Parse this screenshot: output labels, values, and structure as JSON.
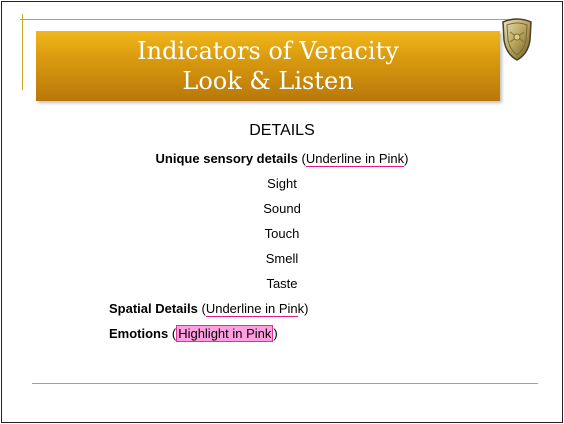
{
  "title": {
    "line1": "Indicators of Veracity",
    "line2": "Look & Listen"
  },
  "crest_icon": "shield-crest-icon",
  "heading": "DETAILS",
  "unique": {
    "bold": "Unique sensory details",
    "open": " (",
    "marked": "Underline in Pink",
    "close": ")"
  },
  "senses": [
    "Sight",
    "Sound",
    "Touch",
    "Smell",
    "Taste"
  ],
  "spatial": {
    "bold": "Spatial Details",
    "open": " (",
    "marked": "Underline in Pin",
    "tail": "k",
    "close": ")"
  },
  "emotions": {
    "bold": "Emotions",
    "open": " (",
    "marked": "Highlight in Pink",
    "close": ")"
  },
  "colors": {
    "accent_gold": "#c9a227",
    "title_orange": "#d99a0f",
    "pink_underline": "#e01c8c",
    "pink_highlight": "#ff9ee0"
  }
}
